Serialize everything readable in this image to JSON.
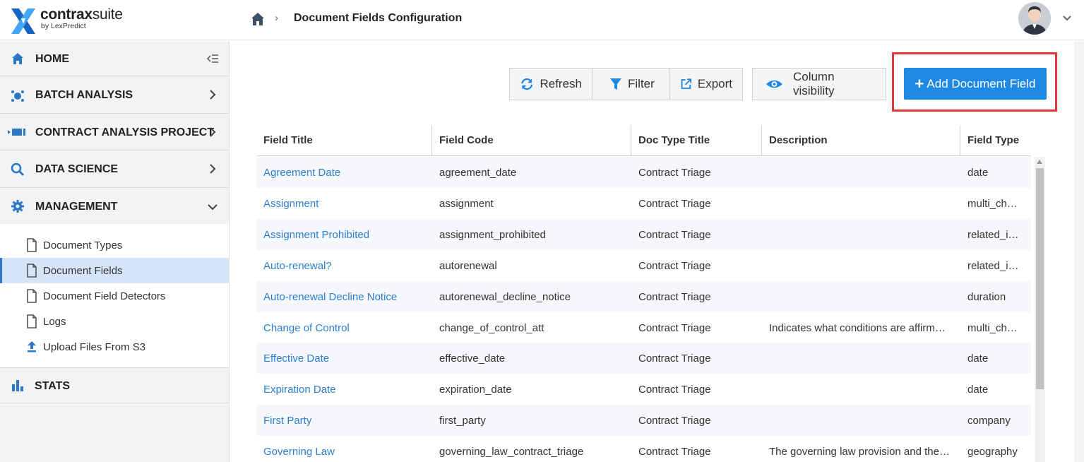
{
  "app": {
    "logo_name_bold": "contrax",
    "logo_name_light": "suite",
    "logo_sub": "by LexPredict"
  },
  "breadcrumb": {
    "home_icon": "home-icon",
    "separator": "›",
    "title": "Document Fields Configuration"
  },
  "sidebar": {
    "nav": [
      {
        "label": "Home",
        "icon": "home-icon"
      },
      {
        "label": "Batch Analysis",
        "icon": "batch-icon"
      },
      {
        "label": "Contract Analysis Project",
        "icon": "project-icon"
      },
      {
        "label": "Data Science",
        "icon": "search-icon"
      },
      {
        "label": "Management",
        "icon": "gear-icon"
      },
      {
        "label": "Stats",
        "icon": "bar-chart-icon"
      }
    ],
    "management_items": [
      {
        "label": "Document Types",
        "icon": "file-icon",
        "active": false
      },
      {
        "label": "Document Fields",
        "icon": "file-icon",
        "active": true
      },
      {
        "label": "Document Field Detectors",
        "icon": "file-icon",
        "active": false
      },
      {
        "label": "Logs",
        "icon": "file-icon",
        "active": false
      },
      {
        "label": "Upload Files From S3",
        "icon": "upload-icon",
        "active": false
      }
    ]
  },
  "toolbar": {
    "refresh": "Refresh",
    "filter": "Filter",
    "export": "Export",
    "column_visibility": "Column visibility",
    "add": "Add Document Field"
  },
  "table": {
    "columns": [
      "Field Title",
      "Field Code",
      "Doc Type Title",
      "Description",
      "Field Type"
    ],
    "rows": [
      [
        "Agreement Date",
        "agreement_date",
        "Contract Triage",
        "",
        "date"
      ],
      [
        "Assignment",
        "assignment",
        "Contract Triage",
        "",
        "multi_ch…"
      ],
      [
        "Assignment Prohibited",
        "assignment_prohibited",
        "Contract Triage",
        "",
        "related_i…"
      ],
      [
        "Auto-renewal?",
        "autorenewal",
        "Contract Triage",
        "",
        "related_i…"
      ],
      [
        "Auto-renewal Decline Notice",
        "autorenewal_decline_notice",
        "Contract Triage",
        "",
        "duration"
      ],
      [
        "Change of Control",
        "change_of_control_att",
        "Contract Triage",
        "Indicates what conditions are affirm…",
        "multi_ch…"
      ],
      [
        "Effective Date",
        "effective_date",
        "Contract Triage",
        "",
        "date"
      ],
      [
        "Expiration Date",
        "expiration_date",
        "Contract Triage",
        "",
        "date"
      ],
      [
        "First Party",
        "first_party",
        "Contract Triage",
        "",
        "company"
      ],
      [
        "Governing Law",
        "governing_law_contract_triage",
        "Contract Triage",
        "The governing law provision and the…",
        "geography"
      ]
    ]
  },
  "colors": {
    "accent": "#1e88e5",
    "link": "#2b7fd0",
    "highlight_border": "#e0343a",
    "active_item": "#d4e5f7"
  }
}
